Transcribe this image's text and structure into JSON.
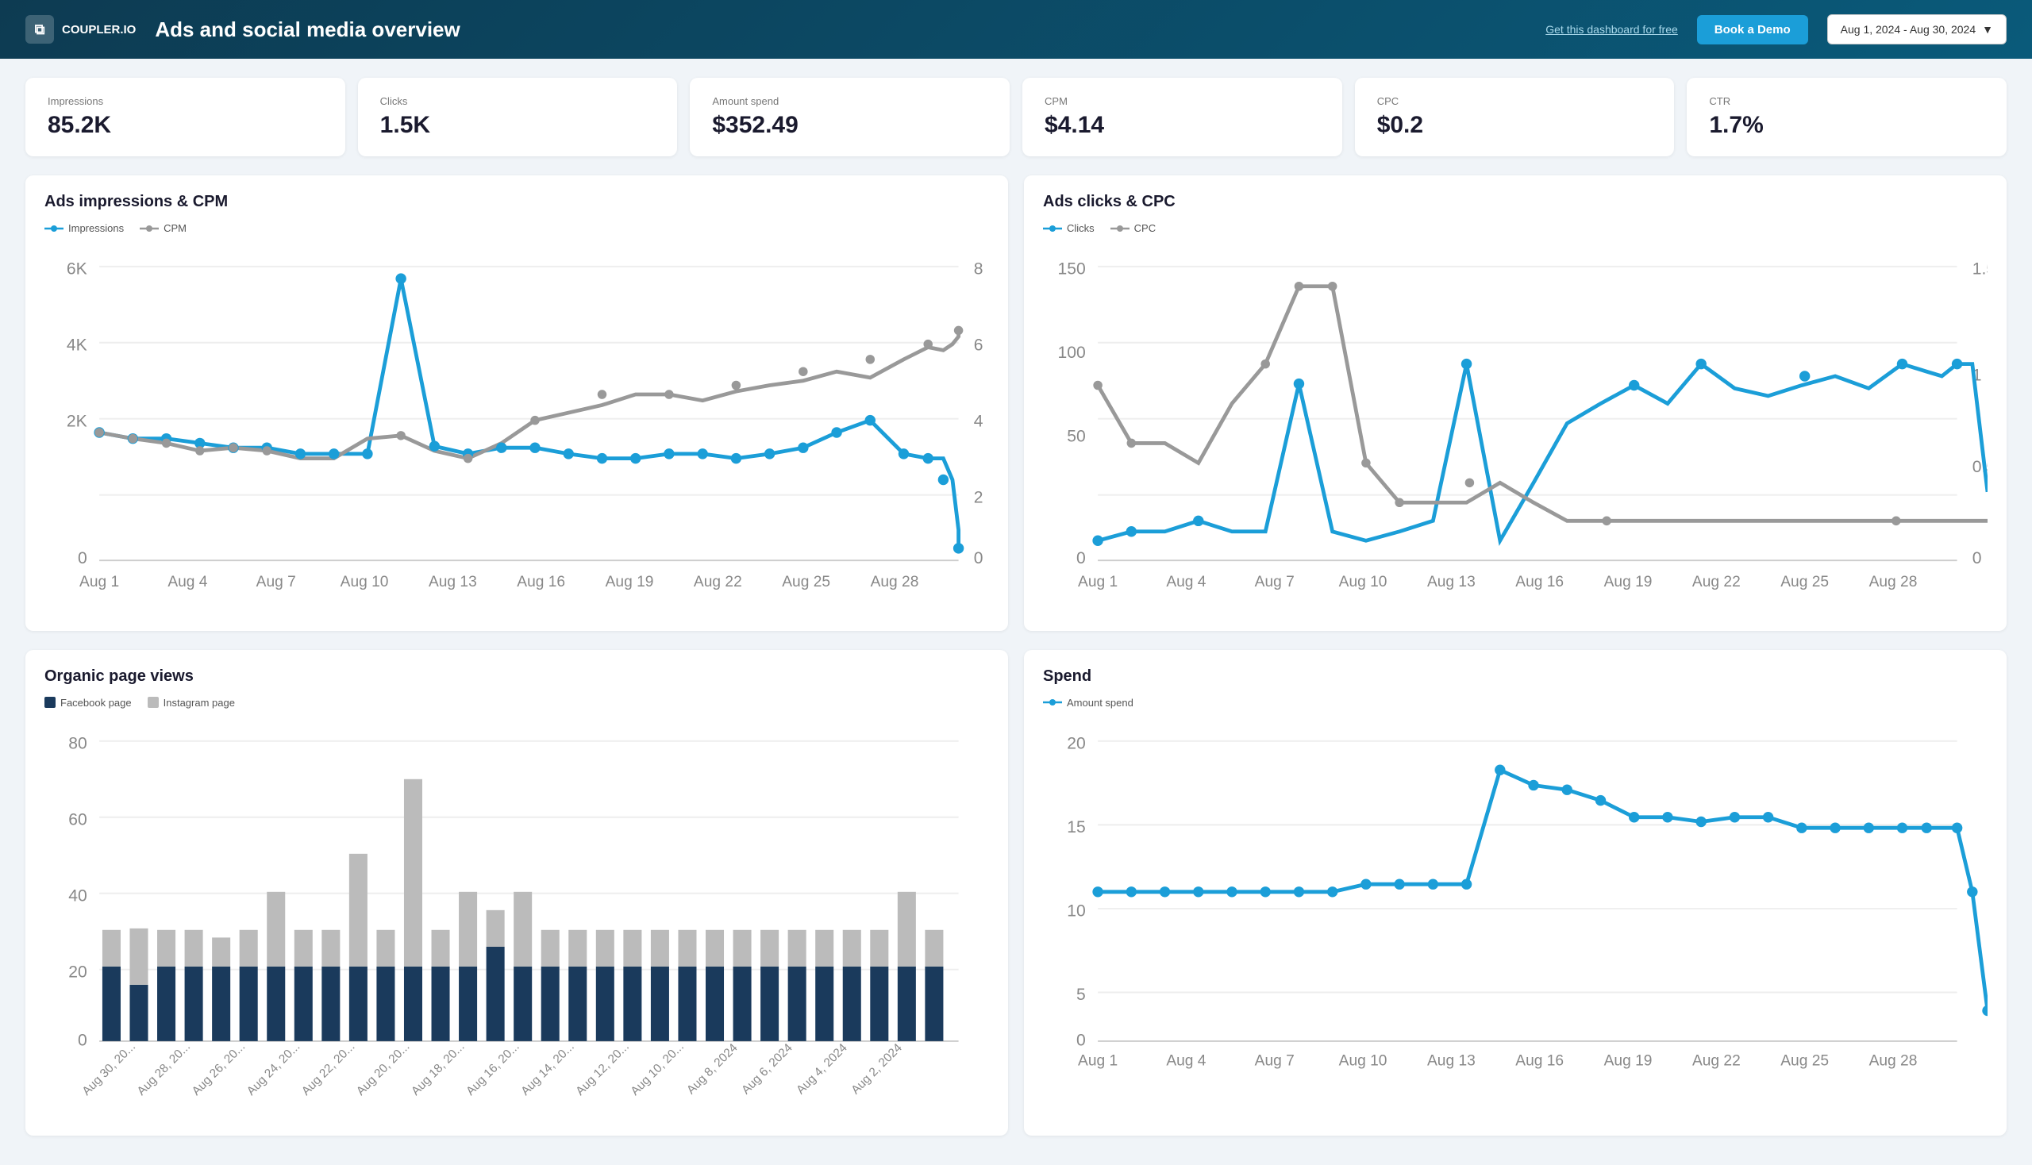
{
  "header": {
    "logo_text": "COUPLER.IO",
    "title": "Ads and social media overview",
    "free_link": "Get this dashboard for free",
    "demo_btn": "Book a Demo",
    "date_range": "Aug 1, 2024 - Aug 30, 2024"
  },
  "kpis": [
    {
      "label": "Impressions",
      "value": "85.2K"
    },
    {
      "label": "Clicks",
      "value": "1.5K"
    },
    {
      "label": "Amount spend",
      "value": "$352.49"
    },
    {
      "label": "CPM",
      "value": "$4.14"
    },
    {
      "label": "CPC",
      "value": "$0.2"
    },
    {
      "label": "CTR",
      "value": "1.7%"
    }
  ],
  "charts": {
    "impressions_cpm": {
      "title": "Ads impressions & CPM",
      "legend": [
        {
          "label": "Impressions",
          "color": "#1b9ed8"
        },
        {
          "label": "CPM",
          "color": "#999"
        }
      ]
    },
    "clicks_cpc": {
      "title": "Ads clicks & CPC",
      "legend": [
        {
          "label": "Clicks",
          "color": "#1b9ed8"
        },
        {
          "label": "CPC",
          "color": "#999"
        }
      ]
    },
    "organic_views": {
      "title": "Organic page views",
      "legend": [
        {
          "label": "Facebook page",
          "color": "#1a3a5c"
        },
        {
          "label": "Instagram page",
          "color": "#bbb"
        }
      ]
    },
    "spend": {
      "title": "Spend",
      "legend": [
        {
          "label": "Amount spend",
          "color": "#1b9ed8"
        }
      ]
    }
  },
  "x_labels_monthly": [
    "Aug 1",
    "Aug 4",
    "Aug 7",
    "Aug 10",
    "Aug 13",
    "Aug 16",
    "Aug 19",
    "Aug 22",
    "Aug 25",
    "Aug 28"
  ]
}
